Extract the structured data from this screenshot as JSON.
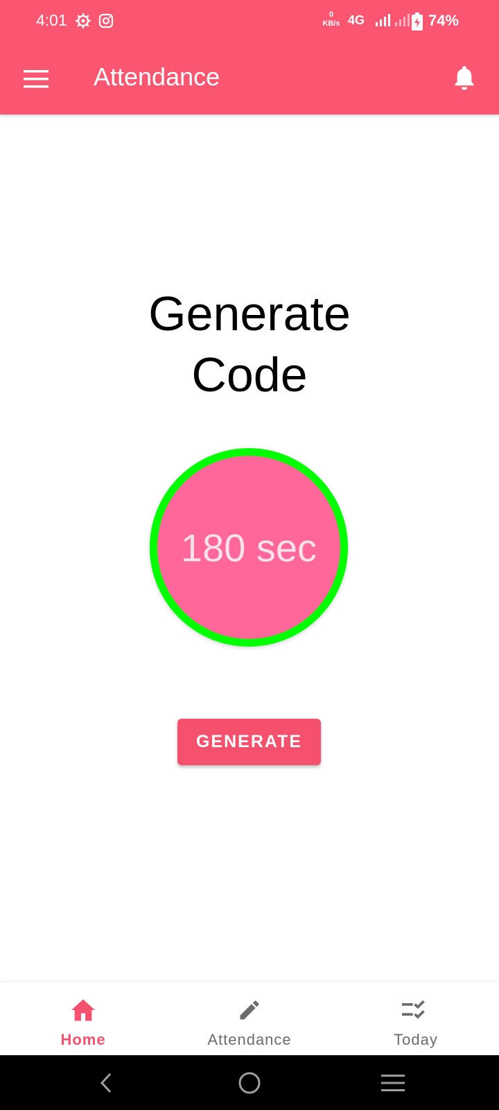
{
  "status_bar": {
    "time": "4:01",
    "left_icons": [
      "settings-gear-icon",
      "instagram-icon"
    ],
    "kbs_value": "0",
    "kbs_unit": "KB/s",
    "network_type": "4G",
    "battery_percent": "74%"
  },
  "toolbar": {
    "title": "Attendance",
    "menu_icon": "hamburger-menu-icon",
    "notification_icon": "bell-icon"
  },
  "main": {
    "heading_line1": "Generate",
    "heading_line2": "Code",
    "timer_text": "180 sec",
    "generate_button_label": "GENERATE"
  },
  "bottom_nav": {
    "items": [
      {
        "label": "Home",
        "icon": "home-icon",
        "active": true
      },
      {
        "label": "Attendance",
        "icon": "pencil-icon",
        "active": false
      },
      {
        "label": "Today",
        "icon": "checklist-icon",
        "active": false
      }
    ]
  },
  "colors": {
    "primary": "#fa5671",
    "button": "#f5516e",
    "timer_fill": "#ff6699",
    "timer_ring": "#00ff00",
    "inactive_nav": "#6b6b6b"
  }
}
